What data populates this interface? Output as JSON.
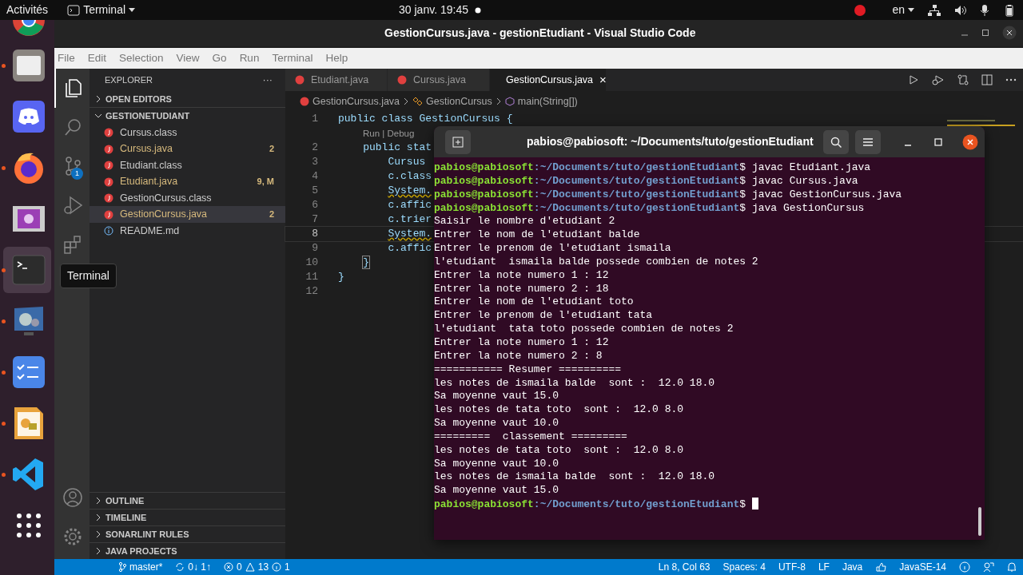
{
  "topbar": {
    "activities": "Activités",
    "app_menu": "Terminal",
    "clock": "30 janv.  19:45",
    "language": "en"
  },
  "dock": [
    {
      "kind": "browser-round",
      "running": false,
      "selected": false
    },
    {
      "kind": "folder",
      "running": true,
      "selected": false
    },
    {
      "kind": "chat",
      "running": false,
      "selected": false
    },
    {
      "kind": "browser",
      "running": true,
      "selected": false
    },
    {
      "kind": "film",
      "running": false,
      "selected": false
    },
    {
      "kind": "terminal",
      "running": true,
      "selected": true
    },
    {
      "kind": "monitor",
      "running": true,
      "selected": false
    },
    {
      "kind": "checklist",
      "running": true,
      "selected": false
    },
    {
      "kind": "draw",
      "running": true,
      "selected": false
    },
    {
      "kind": "code",
      "running": true,
      "selected": false
    },
    {
      "kind": "grid",
      "running": false,
      "selected": false
    }
  ],
  "window": {
    "title": "GestionCursus.java - gestionEtudiant - Visual Studio Code"
  },
  "menu": [
    "File",
    "Edit",
    "Selection",
    "View",
    "Go",
    "Run",
    "Terminal",
    "Help"
  ],
  "activity_bar": [
    {
      "kind": "files",
      "selected": true
    },
    {
      "kind": "search",
      "selected": false
    },
    {
      "kind": "git",
      "selected": false,
      "badge": "1"
    },
    {
      "kind": "debug",
      "selected": false
    },
    {
      "kind": "extensions",
      "selected": false
    }
  ],
  "tooltip": "Terminal",
  "sidebar": {
    "title": "EXPLORER",
    "more": "···",
    "sections_top": [
      {
        "label": "OPEN EDITORS",
        "expanded": false
      },
      {
        "label": "GESTIONETUDIANT",
        "expanded": true
      }
    ],
    "files": [
      {
        "name": "Cursus.class",
        "kind": "java",
        "modified": false,
        "selected": false
      },
      {
        "name": "Cursus.java",
        "kind": "java",
        "modified": true,
        "selected": false,
        "decoration": "2"
      },
      {
        "name": "Etudiant.class",
        "kind": "java",
        "modified": false,
        "selected": false
      },
      {
        "name": "Etudiant.java",
        "kind": "java",
        "modified": true,
        "selected": false,
        "decoration": "9, M"
      },
      {
        "name": "GestionCursus.class",
        "kind": "java",
        "modified": false,
        "selected": false
      },
      {
        "name": "GestionCursus.java",
        "kind": "java",
        "modified": true,
        "selected": true,
        "decoration": "2"
      },
      {
        "name": "README.md",
        "kind": "info",
        "modified": false,
        "selected": false
      }
    ],
    "sections_bottom": [
      {
        "label": "OUTLINE",
        "expanded": false
      },
      {
        "label": "TIMELINE",
        "expanded": false
      },
      {
        "label": "SONARLINT RULES",
        "expanded": false
      },
      {
        "label": "JAVA PROJECTS",
        "expanded": false
      }
    ]
  },
  "tabs": [
    {
      "label": "Etudiant.java",
      "selected": false
    },
    {
      "label": "Cursus.java",
      "selected": false
    },
    {
      "label": "GestionCursus.java",
      "selected": true,
      "close": "×"
    }
  ],
  "breadcrumb": [
    "GestionCursus.java",
    "GestionCursus",
    "main(String[])"
  ],
  "code": [
    {
      "kind": "line",
      "number": "1",
      "text": "public class GestionCursus {"
    },
    {
      "kind": "codelens",
      "text": "Run | Debug"
    },
    {
      "kind": "line",
      "number": "2",
      "text": "    public stat"
    },
    {
      "kind": "line",
      "number": "3",
      "text": "        Cursus"
    },
    {
      "kind": "line",
      "number": "4",
      "text": "        c.class"
    },
    {
      "kind": "line",
      "number": "5",
      "text": "        System.",
      "warning": true
    },
    {
      "kind": "line",
      "number": "6",
      "text": "        c.affic"
    },
    {
      "kind": "line",
      "number": "7",
      "text": "        c.trier"
    },
    {
      "kind": "line",
      "number": "8",
      "text": "        System.",
      "warning": true,
      "current": true
    },
    {
      "kind": "line",
      "number": "9",
      "text": "        c.affic"
    },
    {
      "kind": "line",
      "number": "10",
      "text": "    }",
      "bracket_match": true
    },
    {
      "kind": "line",
      "number": "11",
      "text": "}"
    },
    {
      "kind": "line",
      "number": "12"
    }
  ],
  "terminal": {
    "title": "pabios@pabiosoft: ~/Documents/tuto/gestionEtudiant",
    "lines": [
      {
        "kind": "prompt",
        "user": "pabios@pabiosoft",
        "path": ":~/Documents/tuto/gestionEtudiant",
        "command": "$ javac Etudiant.java"
      },
      {
        "kind": "prompt",
        "user": "pabios@pabiosoft",
        "path": ":~/Documents/tuto/gestionEtudiant",
        "command": "$ javac Cursus.java"
      },
      {
        "kind": "prompt",
        "user": "pabios@pabiosoft",
        "path": ":~/Documents/tuto/gestionEtudiant",
        "command": "$ javac GestionCursus.java"
      },
      {
        "kind": "prompt",
        "user": "pabios@pabiosoft",
        "path": ":~/Documents/tuto/gestionEtudiant",
        "command": "$ java GestionCursus"
      },
      {
        "kind": "output",
        "text": "Saisir le nombre d'etudiant 2"
      },
      {
        "kind": "output",
        "text": "Entrer le nom de l'etudiant balde"
      },
      {
        "kind": "output",
        "text": "Entrer le prenom de l'etudiant ismaila"
      },
      {
        "kind": "output",
        "text": "l'etudiant  ismaila balde possede combien de notes 2"
      },
      {
        "kind": "output",
        "text": "Entrer la note numero 1 : 12"
      },
      {
        "kind": "output",
        "text": "Entrer la note numero 2 : 18"
      },
      {
        "kind": "output",
        "text": "Entrer le nom de l'etudiant toto"
      },
      {
        "kind": "output",
        "text": "Entrer le prenom de l'etudiant tata"
      },
      {
        "kind": "output",
        "text": "l'etudiant  tata toto possede combien de notes 2"
      },
      {
        "kind": "output",
        "text": "Entrer la note numero 1 : 12"
      },
      {
        "kind": "output",
        "text": "Entrer la note numero 2 : 8"
      },
      {
        "kind": "output",
        "text": "=========== Resumer =========="
      },
      {
        "kind": "output",
        "text": "les notes de ismaila balde  sont :  12.0 18.0"
      },
      {
        "kind": "output",
        "text": "Sa moyenne vaut 15.0"
      },
      {
        "kind": "output",
        "text": "les notes de tata toto  sont :  12.0 8.0"
      },
      {
        "kind": "output",
        "text": "Sa moyenne vaut 10.0"
      },
      {
        "kind": "output",
        "text": "=========  classement ========="
      },
      {
        "kind": "output",
        "text": "les notes de tata toto  sont :  12.0 8.0"
      },
      {
        "kind": "output",
        "text": "Sa moyenne vaut 10.0"
      },
      {
        "kind": "output",
        "text": "les notes de ismaila balde  sont :  12.0 18.0"
      },
      {
        "kind": "output",
        "text": "Sa moyenne vaut 15.0"
      },
      {
        "kind": "prompt",
        "user": "pabios@pabiosoft",
        "path": ":~/Documents/tuto/gestionEtudiant",
        "command": "$ ",
        "cursor": true
      }
    ]
  },
  "status_bar": {
    "branch": "master*",
    "sync": "0↓ 1↑",
    "errors": "0",
    "warnings": "13",
    "infos": "1",
    "right": [
      "Ln 8, Col 63",
      "Spaces: 4",
      "UTF-8",
      "LF",
      "Java",
      "JavaSE-14"
    ]
  }
}
